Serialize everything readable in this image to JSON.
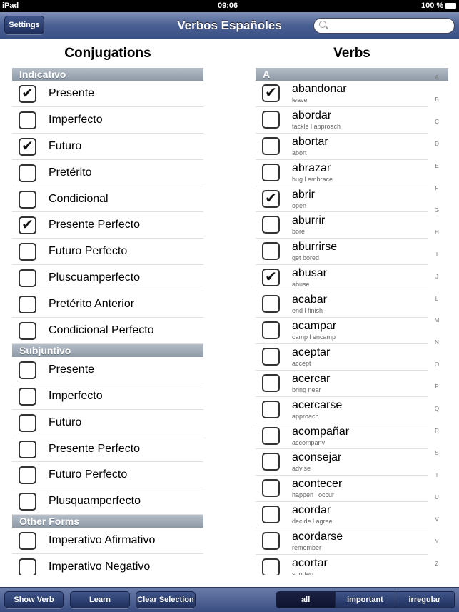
{
  "status": {
    "device": "iPad",
    "time": "09:06",
    "battery": "100 %"
  },
  "nav": {
    "settings": "Settings",
    "title": "Verbos Españoles",
    "search_placeholder": ""
  },
  "conjugations": {
    "title": "Conjugations",
    "sections": [
      {
        "header": "Indicativo",
        "items": [
          {
            "label": "Presente",
            "checked": true
          },
          {
            "label": "Imperfecto",
            "checked": false
          },
          {
            "label": "Futuro",
            "checked": true
          },
          {
            "label": "Pretérito",
            "checked": false
          },
          {
            "label": "Condicional",
            "checked": false
          },
          {
            "label": "Presente Perfecto",
            "checked": true
          },
          {
            "label": "Futuro Perfecto",
            "checked": false
          },
          {
            "label": "Pluscuamperfecto",
            "checked": false
          },
          {
            "label": "Pretérito Anterior",
            "checked": false
          },
          {
            "label": "Condicional Perfecto",
            "checked": false
          }
        ]
      },
      {
        "header": "Subjuntivo",
        "items": [
          {
            "label": "Presente",
            "checked": false
          },
          {
            "label": "Imperfecto",
            "checked": false
          },
          {
            "label": "Futuro",
            "checked": false
          },
          {
            "label": "Presente Perfecto",
            "checked": false
          },
          {
            "label": "Futuro Perfecto",
            "checked": false
          },
          {
            "label": "Plusquamperfecto",
            "checked": false
          }
        ]
      },
      {
        "header": "Other Forms",
        "items": [
          {
            "label": "Imperativo Afirmativo",
            "checked": false
          },
          {
            "label": "Imperativo Negativo",
            "checked": false
          }
        ]
      }
    ]
  },
  "verbs": {
    "title": "Verbs",
    "sections": [
      {
        "header": "A",
        "items": [
          {
            "verb": "abandonar",
            "translation": "leave",
            "checked": true
          },
          {
            "verb": "abordar",
            "translation": "tackle l approach",
            "checked": false
          },
          {
            "verb": "abortar",
            "translation": "abort",
            "checked": false
          },
          {
            "verb": "abrazar",
            "translation": "hug l embrace",
            "checked": false
          },
          {
            "verb": "abrir",
            "translation": "open",
            "checked": true
          },
          {
            "verb": "aburrir",
            "translation": "bore",
            "checked": false
          },
          {
            "verb": "aburrirse",
            "translation": "get bored",
            "checked": false
          },
          {
            "verb": "abusar",
            "translation": "abuse",
            "checked": true
          },
          {
            "verb": "acabar",
            "translation": "end l finish",
            "checked": false
          },
          {
            "verb": "acampar",
            "translation": "camp l encamp",
            "checked": false
          },
          {
            "verb": "aceptar",
            "translation": "accept",
            "checked": false
          },
          {
            "verb": "acercar",
            "translation": "bring near",
            "checked": false
          },
          {
            "verb": "acercarse",
            "translation": "approach",
            "checked": false
          },
          {
            "verb": "acompañar",
            "translation": "accompany",
            "checked": false
          },
          {
            "verb": "aconsejar",
            "translation": "advise",
            "checked": false
          },
          {
            "verb": "acontecer",
            "translation": "happen l occur",
            "checked": false
          },
          {
            "verb": "acordar",
            "translation": "decide l agree",
            "checked": false
          },
          {
            "verb": "acordarse",
            "translation": "remember",
            "checked": false
          },
          {
            "verb": "acortar",
            "translation": "shorten",
            "checked": false
          }
        ]
      }
    ],
    "index": [
      "A",
      "B",
      "C",
      "D",
      "E",
      "F",
      "G",
      "H",
      "I",
      "J",
      "L",
      "M",
      "N",
      "O",
      "P",
      "Q",
      "R",
      "S",
      "T",
      "U",
      "V",
      "Y",
      "Z"
    ]
  },
  "toolbar": {
    "show_verb": "Show Verb",
    "learn": "Learn",
    "clear": "Clear Selection",
    "filters": [
      {
        "label": "all",
        "selected": true
      },
      {
        "label": "important",
        "selected": false
      },
      {
        "label": "irregular",
        "selected": false
      }
    ]
  }
}
